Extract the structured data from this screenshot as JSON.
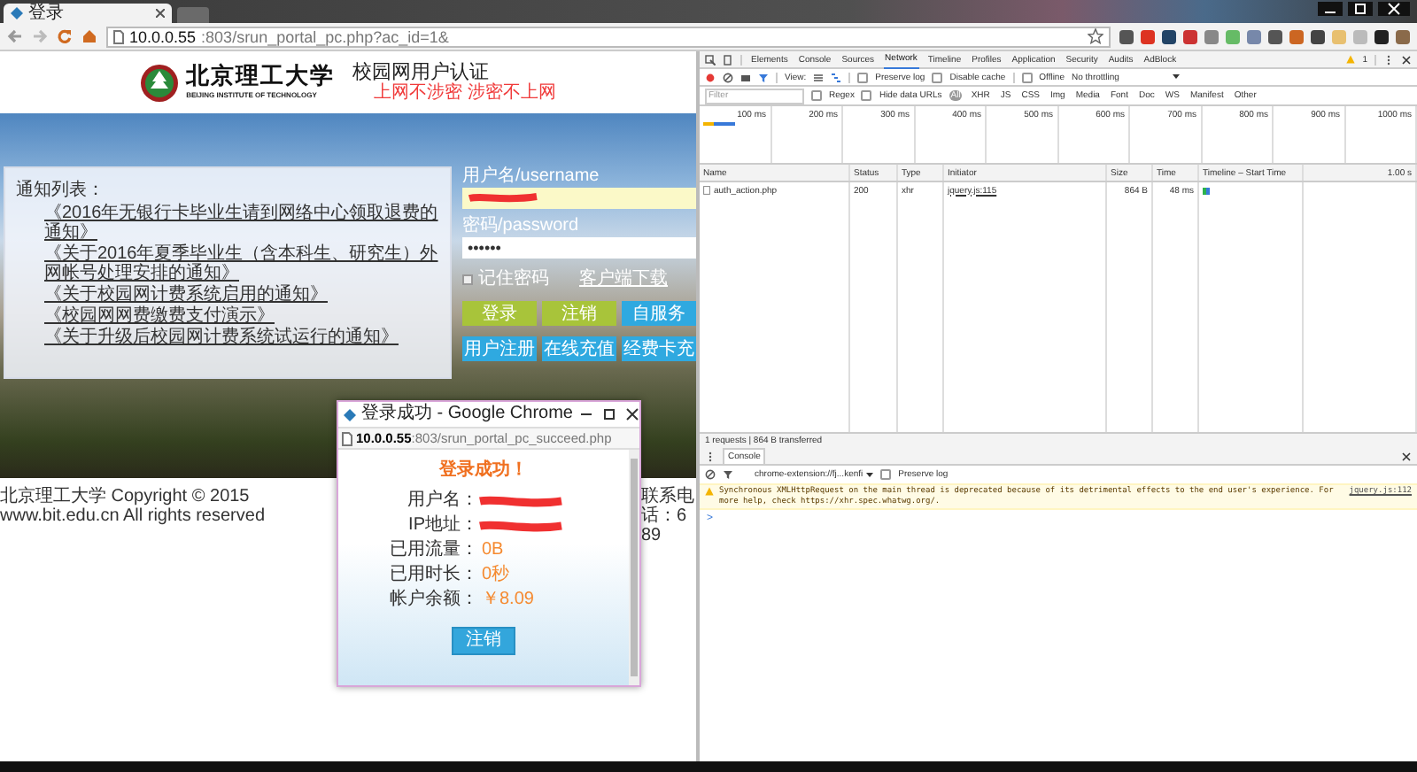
{
  "browser": {
    "tab": {
      "title": "登录"
    },
    "address": {
      "host": "10.0.0.55",
      "path": ":803/srun_portal_pc.php?ac_id=1&"
    }
  },
  "portal": {
    "university_name": "北京理工大学",
    "university_name_en": "BEIJING INSTITUTE OF TECHNOLOGY",
    "system_title": "校园网用户认证",
    "slogan": "上网不涉密 涉密不上网",
    "notices": {
      "heading": "通知列表：",
      "items": [
        "《2016年无银行卡毕业生请到网络中心领取退费的通知》",
        "《关于2016年夏季毕业生（含本科生、研究生）外网帐号处理安排的通知》",
        "《关于校园网计费系统启用的通知》",
        "《校园网网费缴费支付演示》",
        "《关于升级后校园网计费系统试运行的通知》"
      ]
    },
    "login": {
      "username_label": "用户名/username",
      "password_label": "密码/password",
      "password_value": "••••••",
      "remember": {
        "label": "记住密码",
        "checked": false
      },
      "client_download": "客户端下载",
      "buttons": [
        {
          "label": "登录",
          "color": "#a8c43a"
        },
        {
          "label": "注销",
          "color": "#a8c43a"
        },
        {
          "label": "自服务",
          "color": "#2fa9e0"
        },
        {
          "label": "用户注册",
          "color": "#2fa9e0"
        },
        {
          "label": "在线充值",
          "color": "#2fa9e0"
        },
        {
          "label": "经费卡充",
          "color": "#2fa9e0"
        }
      ]
    },
    "footer": {
      "copyright": "北京理工大学 Copyright © 2015 www.bit.edu.cn All rights reserved",
      "contact": "联系电话：689"
    }
  },
  "devtools": {
    "tabs": [
      {
        "label": "Elements",
        "selected": false
      },
      {
        "label": "Console",
        "selected": false
      },
      {
        "label": "Sources",
        "selected": false
      },
      {
        "label": "Network",
        "selected": true
      },
      {
        "label": "Timeline",
        "selected": false
      },
      {
        "label": "Profiles",
        "selected": false
      },
      {
        "label": "Application",
        "selected": false
      },
      {
        "label": "Security",
        "selected": false
      },
      {
        "label": "Audits",
        "selected": false
      },
      {
        "label": "AdBlock",
        "selected": false
      }
    ],
    "warning_count": "1",
    "toolbar": {
      "view_label": "View:",
      "preserve_log": {
        "label": "Preserve log",
        "checked": false
      },
      "disable_cache": {
        "label": "Disable cache",
        "checked": false
      },
      "offline": {
        "label": "Offline",
        "checked": false
      },
      "throttling": "No throttling"
    },
    "filter": {
      "placeholder": "Filter",
      "regex": {
        "label": "Regex",
        "checked": false
      },
      "hide_data_urls": {
        "label": "Hide data URLs",
        "checked": false
      },
      "types": [
        {
          "label": "All",
          "selected": true
        },
        {
          "label": "XHR",
          "selected": false
        },
        {
          "label": "JS",
          "selected": false
        },
        {
          "label": "CSS",
          "selected": false
        },
        {
          "label": "Img",
          "selected": false
        },
        {
          "label": "Media",
          "selected": false
        },
        {
          "label": "Font",
          "selected": false
        },
        {
          "label": "Doc",
          "selected": false
        },
        {
          "label": "WS",
          "selected": false
        },
        {
          "label": "Manifest",
          "selected": false
        },
        {
          "label": "Other",
          "selected": false
        }
      ]
    },
    "overview": {
      "ticks": [
        "100 ms",
        "200 ms",
        "300 ms",
        "400 ms",
        "500 ms",
        "600 ms",
        "700 ms",
        "800 ms",
        "900 ms",
        "1000 ms"
      ]
    },
    "table": {
      "columns": [
        "Name",
        "Status",
        "Type",
        "Initiator",
        "Size",
        "Time",
        "Timeline – Start Time"
      ],
      "scale": "1.00 s",
      "rows": [
        {
          "name": "auth_action.php",
          "status": "200",
          "type": "xhr",
          "initiator": "jquery.js:115",
          "size": "864 B",
          "time": "48 ms"
        }
      ]
    },
    "status": "1 requests | 864 B transferred",
    "console": {
      "tab": "Console",
      "context": "chrome-extension://fj...kenfi",
      "preserve_log": {
        "label": "Preserve log",
        "checked": false
      },
      "messages": [
        {
          "kind": "warning",
          "text": "Synchronous XMLHttpRequest on the main thread is deprecated because of its detrimental effects to the end user's experience. For more help, check https://xhr.spec.whatwg.org/.",
          "source": "jquery.js:112"
        }
      ],
      "prompt": ">"
    }
  },
  "popup": {
    "title": "登录成功 - Google Chrome",
    "address": {
      "host": "10.0.0.55",
      "path": ":803/srun_portal_pc_succeed.php"
    },
    "heading": "登录成功！",
    "fields": [
      {
        "label": "用户名：",
        "kind": "redacted"
      },
      {
        "label": "IP地址：",
        "kind": "redacted"
      },
      {
        "label": "已用流量：",
        "kind": "value",
        "value": "0B"
      },
      {
        "label": "已用时长：",
        "kind": "value",
        "value": "0秒"
      },
      {
        "label": "帐户余额：",
        "kind": "value",
        "value": "￥8.09"
      }
    ],
    "button": "注销"
  }
}
